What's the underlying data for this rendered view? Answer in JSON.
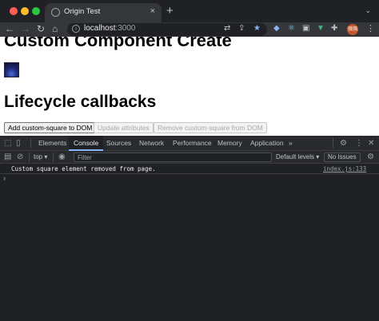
{
  "browser": {
    "tab_title": "Origin Test",
    "tab_close": "×",
    "new_tab": "+",
    "tab_menu": "⌄",
    "url_host": "localhost",
    "url_port": ":3000",
    "avatar_text": "强强"
  },
  "page": {
    "heading": "Custom Component Create",
    "subheading": "Lifecycle callbacks",
    "buttons": {
      "add": "Add custom-square to DOM",
      "update": "Update attributes",
      "remove": "Remove custom-square from DOM"
    }
  },
  "devtools": {
    "tabs": [
      "Elements",
      "Console",
      "Sources",
      "Network",
      "Performance",
      "Memory",
      "Application"
    ],
    "active_tab": "Console",
    "more_tabs": "»",
    "context": "top",
    "filter_placeholder": "Filter",
    "levels": "Default levels",
    "issues": "No Issues",
    "log": {
      "message": "Custom square element removed from page.",
      "source": "index.js:133"
    },
    "prompt": "›"
  }
}
